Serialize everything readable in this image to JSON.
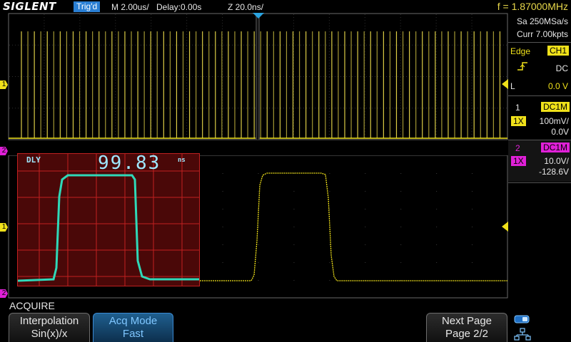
{
  "topbar": {
    "logo": "SIGLENT",
    "trigger_status": "Trig'd",
    "timebase": "M 2.00us/",
    "delay": "Delay:0.00s",
    "zoom": "Z 20.0ns/",
    "frequency": "f = 1.87000MHz"
  },
  "acquisition": {
    "sample_rate": "Sa 250MSa/s",
    "memory": "Curr 7.00kpts"
  },
  "trigger": {
    "type": "Edge",
    "source": "CH1",
    "coupling": "DC",
    "level_mode": "L",
    "level": "0.0 V"
  },
  "channel1": {
    "number": "1",
    "coupling": "DC1M",
    "probe": "1X",
    "scale": "100mV/",
    "offset": "0.0V"
  },
  "channel2": {
    "number": "2",
    "coupling": "DC1M",
    "probe": "1X",
    "scale": "10.0V/",
    "offset": "-128.6V"
  },
  "markers": {
    "ch1_main": "1",
    "ch2_main": "2",
    "ch1_zoom": "1",
    "ch2_zoom": "2"
  },
  "inset": {
    "label": "DLY",
    "value": "99.83",
    "unit": "ns"
  },
  "menu": {
    "title": "ACQUIRE",
    "interpolation_label": "Interpolation",
    "interpolation_value": "Sin(x)/x",
    "acq_mode_label": "Acq Mode",
    "acq_mode_value": "Fast",
    "next_page_label": "Next Page",
    "next_page_value": "Page 2/2"
  },
  "colors": {
    "ch1": "#f0e11a",
    "ch2": "#e020d8",
    "accent": "#2a7fd4",
    "inset_trace": "#2fd8b8",
    "inset_bg": "#5a0a0a"
  }
}
